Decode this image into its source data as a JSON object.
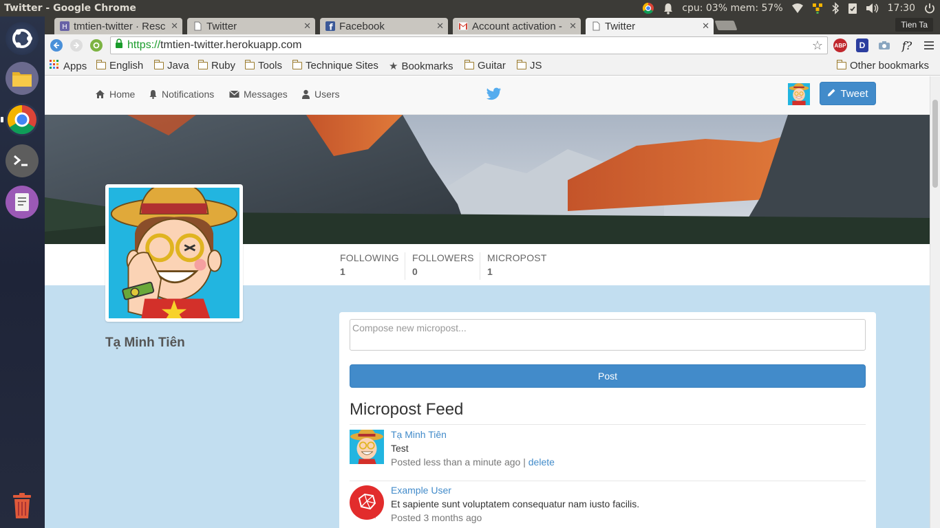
{
  "window": {
    "title": "Twitter - Google Chrome"
  },
  "top_panel": {
    "cpu_mem": "cpu: 03% mem: 57%",
    "clock": "17:30",
    "indicators": [
      "chrome-icon",
      "bell-icon",
      "wifi-icon",
      "network-icon",
      "bluetooth-icon",
      "clipboard-icon",
      "volume-icon",
      "power-icon"
    ]
  },
  "launcher": [
    "ubuntu-dash-icon",
    "files-icon",
    "chrome-icon",
    "terminal-icon",
    "text-editor-icon",
    "trash-icon"
  ],
  "tabs": [
    {
      "label": "tmtien-twitter · Resc",
      "favicon": "heroku-icon",
      "active": false
    },
    {
      "label": "Twitter",
      "favicon": "page-icon",
      "active": false
    },
    {
      "label": "Facebook",
      "favicon": "facebook-icon",
      "active": false
    },
    {
      "label": "Account activation -",
      "favicon": "gmail-icon",
      "active": false
    },
    {
      "label": "Twitter",
      "favicon": "page-icon",
      "active": true
    }
  ],
  "profile_label": "Tien Ta",
  "omnibox": {
    "scheme": "https://",
    "host": "tmtien-twitter.herokuapp.com"
  },
  "extensions": {
    "abp": "ABP",
    "d": "D",
    "fq": "f?"
  },
  "bookmarks": [
    {
      "label": "Apps",
      "kind": "apps"
    },
    {
      "label": "English",
      "kind": "folder"
    },
    {
      "label": "Java",
      "kind": "folder"
    },
    {
      "label": "Ruby",
      "kind": "folder"
    },
    {
      "label": "Tools",
      "kind": "folder"
    },
    {
      "label": "Technique Sites",
      "kind": "folder"
    },
    {
      "label": "Bookmarks",
      "kind": "star"
    },
    {
      "label": "Guitar",
      "kind": "folder"
    },
    {
      "label": "JS",
      "kind": "folder"
    }
  ],
  "other_bookmarks": "Other bookmarks",
  "site_nav": {
    "home": "Home",
    "notifications": "Notifications",
    "messages": "Messages",
    "users": "Users",
    "tweet": "Tweet"
  },
  "stats": [
    {
      "label": "FOLLOWING",
      "value": "1"
    },
    {
      "label": "FOLLOWERS",
      "value": "0"
    },
    {
      "label": "MICROPOST",
      "value": "1"
    }
  ],
  "profile": {
    "name": "Tạ Minh Tiên"
  },
  "composer": {
    "placeholder": "Compose new micropost...",
    "value": "",
    "button": "Post"
  },
  "feed": {
    "title": "Micropost Feed",
    "posts": [
      {
        "author": "Tạ Minh Tiên",
        "content": "Test",
        "time": "Posted less than a minute ago",
        "separator": " | ",
        "delete": "delete"
      },
      {
        "author": "Example User",
        "content": "Et sapiente sunt voluptatem consequatur nam iusto facilis.",
        "time": "Posted 3 months ago"
      }
    ]
  },
  "colors": {
    "primary": "#428bca",
    "page_bg": "#c2def0",
    "twitter_blue": "#55acee",
    "scheme_green": "#1a9c2b"
  }
}
